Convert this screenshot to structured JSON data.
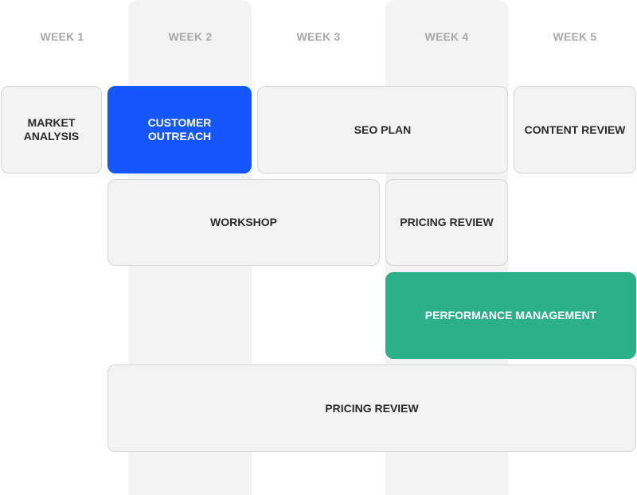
{
  "weeks": [
    "WEEK 1",
    "WEEK 2",
    "WEEK 3",
    "WEEK 4",
    "WEEK 5"
  ],
  "tasks": {
    "market_analysis": "MARKET ANALYSIS",
    "customer_outreach": "CUSTOMER OUTREACH",
    "seo_plan": "SEO PLAN",
    "content_review": "CONTENT REVIEW",
    "workshop": "WORKSHOP",
    "pricing_review_1": "PRICING REVIEW",
    "performance_management": "PERFORMANCE MANAGEMENT",
    "pricing_review_2": "PRICING REVIEW"
  },
  "colors": {
    "highlight_blue": "#1557ff",
    "highlight_green": "#2bb08a",
    "column_band": "#f3f3f3"
  }
}
